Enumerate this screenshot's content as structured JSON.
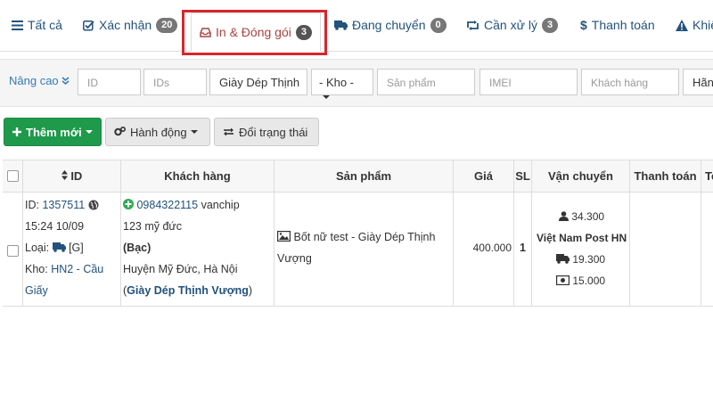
{
  "tabs": [
    {
      "label": "Tất cả",
      "icon": "list-icon"
    },
    {
      "label": "Xác nhận",
      "icon": "check-square-icon",
      "badge": "20"
    },
    {
      "label": "In & Đóng gói",
      "icon": "inbox-icon",
      "badge": "3",
      "active": true
    },
    {
      "label": "Đang chuyển",
      "icon": "truck-icon",
      "badge": "0"
    },
    {
      "label": "Cần xử lý",
      "icon": "retweet-icon",
      "badge": "3"
    },
    {
      "label": "Thanh toán",
      "icon": "dollar-icon"
    },
    {
      "label": "Khiế",
      "icon": "warning-icon"
    }
  ],
  "filters": {
    "advanced_label": "Nâng cao",
    "id_placeholder": "ID",
    "ids_placeholder": "IDs",
    "shop_value": "Giày Dép Thịnh",
    "warehouse_value": "- Kho -",
    "product_placeholder": "Sản phẩm",
    "imei_placeholder": "IMEI",
    "customer_placeholder": "Khách hàng",
    "last_value": "Hãn"
  },
  "actions": {
    "add_label": "Thêm mới",
    "actions_label": "Hành động",
    "change_status_label": "Đổi trạng thái"
  },
  "table": {
    "headers": {
      "id": "ID",
      "customer": "Khách hàng",
      "product": "Sản phẩm",
      "price": "Giá",
      "qty": "SL",
      "shipping": "Vận chuyển",
      "payment": "Thanh toán",
      "extra": "Te"
    },
    "rows": [
      {
        "id_label": "ID:",
        "id": "1357511",
        "time": "15:24 10/09",
        "type_label": "Loại:",
        "type_value": "[G]",
        "warehouse_label": "Kho:",
        "warehouse_value": "HN2 - Cầu",
        "warehouse_value2": "Giấy",
        "phone": "0984322115",
        "customer_name": "vanchip",
        "address1": "123 mỹ đức",
        "tier": "(Bạc)",
        "address2": "Huyện Mỹ Đức, Hà Nội",
        "shop_open": "(",
        "shop": "Giày Dép Thịnh Vượng",
        "shop_close": ")",
        "product_line1": "Bốt nữ test - Giày Dép Thịnh",
        "product_line2": "Vượng",
        "price": "400.000",
        "qty": "1",
        "ship_cod": "34.300",
        "carrier": "Việt Nam Post HN",
        "ship_fee": "19.300",
        "ship_money": "15.000"
      }
    ]
  },
  "colors": {
    "link": "#23527c",
    "active_tab": "#a94442",
    "highlight": "#d9262b",
    "green": "#1e9a4a",
    "badge": "#777777"
  }
}
